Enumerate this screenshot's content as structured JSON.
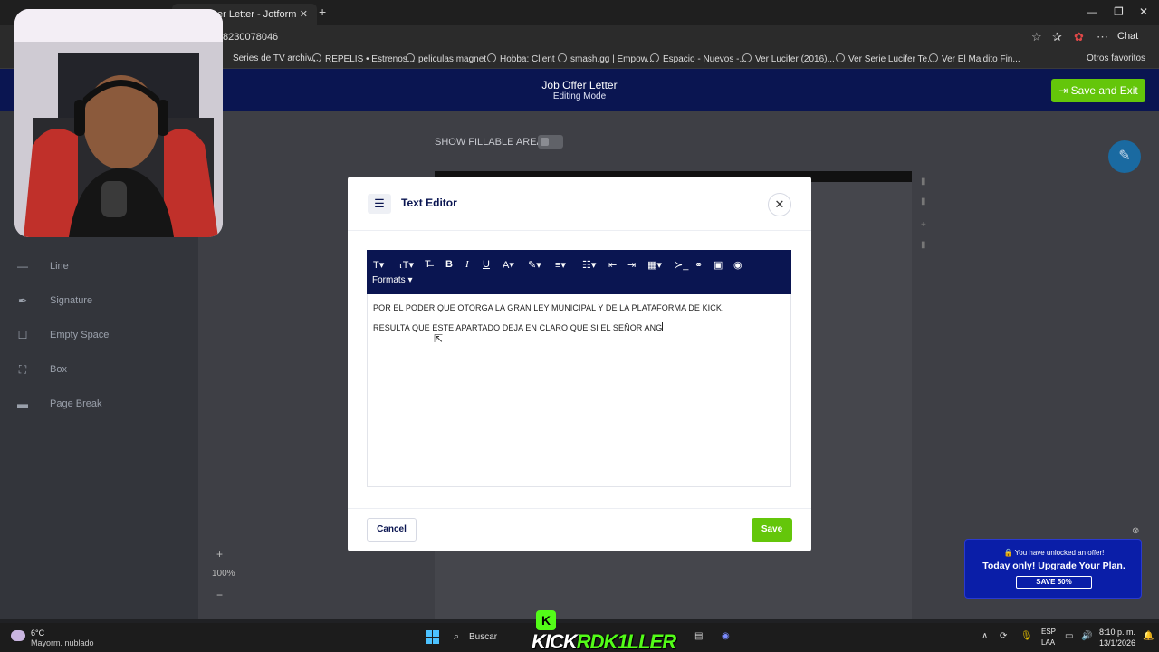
{
  "browser": {
    "tab_title": "er Letter - Jotform Sign",
    "url": "8230078046",
    "chat_label": "Chat",
    "bookmarks": [
      "Series de TV archiv...",
      "REPELIS • Estrenos...",
      "peliculas magnet",
      "Hobba: Client",
      "smash.gg | Empow...",
      "Espacio - Nuevos -...",
      "Ver Lucifer (2016)...",
      "Ver Serie Lucifer Te...",
      "Ver El Maldito Fin..."
    ],
    "other_bookmarks": "Otros favoritos"
  },
  "header": {
    "title": "Job Offer Letter",
    "subtitle": "Editing Mode",
    "save_exit": "Save and Exit"
  },
  "canvas": {
    "show_fillable": "SHOW FILLABLE AREAS"
  },
  "sidebar": {
    "items": [
      {
        "label": "Line",
        "icon": "line-icon"
      },
      {
        "label": "Signature",
        "icon": "pen-icon"
      },
      {
        "label": "Empty Space",
        "icon": "square-icon"
      },
      {
        "label": "Box",
        "icon": "box-icon"
      },
      {
        "label": "Page Break",
        "icon": "page-break-icon"
      }
    ],
    "zoom": "100%"
  },
  "modal": {
    "title": "Text Editor",
    "formats_label": "Formats",
    "content": [
      "POR EL PODER QUE OTORGA LA GRAN LEY MUNICIPAL Y DE LA PLATAFORMA DE KICK.",
      "RESULTA QUE ESTE APARTADO DEJA EN CLARO QUE SI EL SEÑOR ANG"
    ],
    "cancel": "Cancel",
    "save": "Save"
  },
  "offer": {
    "unlocked": "You have unlocked an offer!",
    "headline": "Today only! Upgrade Your Plan.",
    "button": "SAVE 50%"
  },
  "taskbar": {
    "temp": "6°C",
    "weather": "Mayorm. nublado",
    "search": "Buscar",
    "overlay_text": "KICK",
    "overlay_name": "RDK1LLER",
    "lang1": "ESP",
    "lang2": "LAA",
    "time": "8:10 p. m.",
    "date": "13/1/2026"
  },
  "colors": {
    "brand_navy": "#0a1551",
    "accent_green": "#64c60a",
    "kick_green": "#53fc18"
  }
}
